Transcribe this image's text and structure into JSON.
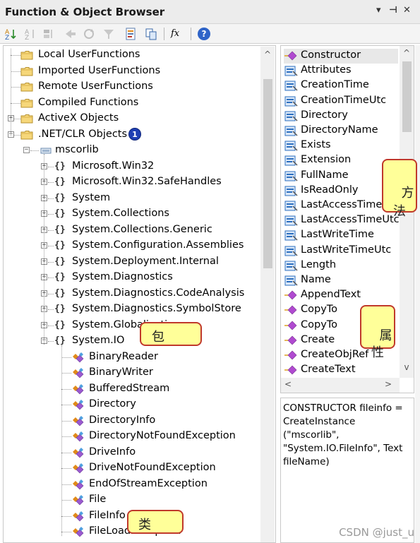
{
  "window": {
    "title": "Function & Object Browser",
    "controls": {
      "menu": "▾",
      "pin": "⊣",
      "close": "✕"
    }
  },
  "toolbar": {
    "icons": [
      "sort-icon",
      "sort-disabled-icon",
      "sort-disabled-icon",
      "arrow-disabled-icon",
      "refresh-disabled-icon",
      "filter-disabled-icon",
      "properties-icon",
      "copy-icon",
      "function-icon",
      "help-icon"
    ],
    "function_label": "fx",
    "help_label": "?"
  },
  "tree": {
    "root_folders": [
      {
        "label": "Local UserFunctions"
      },
      {
        "label": "Imported UserFunctions"
      },
      {
        "label": "Remote UserFunctions"
      },
      {
        "label": "Compiled Functions"
      },
      {
        "label": "ActiveX Objects"
      },
      {
        "label": ".NET/CLR Objects"
      }
    ],
    "assembly": "mscorlib",
    "namespaces": [
      "Microsoft.Win32",
      "Microsoft.Win32.SafeHandles",
      "System",
      "System.Collections",
      "System.Collections.Generic",
      "System.Configuration.Assemblies",
      "System.Deployment.Internal",
      "System.Diagnostics",
      "System.Diagnostics.CodeAnalysis",
      "System.Diagnostics.SymbolStore",
      "System.Globalization",
      "System.IO"
    ],
    "classes": [
      "BinaryReader",
      "BinaryWriter",
      "BufferedStream",
      "Directory",
      "DirectoryInfo",
      "DirectoryNotFoundException",
      "DriveInfo",
      "DriveNotFoundException",
      "EndOfStreamException",
      "File",
      "FileInfo",
      "FileLoadException"
    ],
    "ns_glyph": "{}",
    "expand_glyph": "+",
    "collapse_glyph": "−"
  },
  "members": {
    "items": [
      {
        "label": "Constructor",
        "kind": "method"
      },
      {
        "label": "Attributes",
        "kind": "property"
      },
      {
        "label": "CreationTime",
        "kind": "property"
      },
      {
        "label": "CreationTimeUtc",
        "kind": "property"
      },
      {
        "label": "Directory",
        "kind": "property"
      },
      {
        "label": "DirectoryName",
        "kind": "property"
      },
      {
        "label": "Exists",
        "kind": "property"
      },
      {
        "label": "Extension",
        "kind": "property"
      },
      {
        "label": "FullName",
        "kind": "property"
      },
      {
        "label": "IsReadOnly",
        "kind": "property"
      },
      {
        "label": "LastAccessTime",
        "kind": "property"
      },
      {
        "label": "LastAccessTimeUtc",
        "kind": "property"
      },
      {
        "label": "LastWriteTime",
        "kind": "property"
      },
      {
        "label": "LastWriteTimeUtc",
        "kind": "property"
      },
      {
        "label": "Length",
        "kind": "property"
      },
      {
        "label": "Name",
        "kind": "property"
      },
      {
        "label": "AppendText",
        "kind": "method"
      },
      {
        "label": "CopyTo",
        "kind": "method"
      },
      {
        "label": "CopyTo",
        "kind": "method"
      },
      {
        "label": "Create",
        "kind": "method"
      },
      {
        "label": "CreateObjRef",
        "kind": "method"
      },
      {
        "label": "CreateText",
        "kind": "method"
      }
    ]
  },
  "description": {
    "text": "CONSTRUCTOR fileinfo = CreateInstance (\"mscorlib\", \"System.IO.FileInfo\", Text fileName)"
  },
  "annotations": {
    "badge": "1",
    "package": "包",
    "method": "方\n法",
    "property": "属\n性",
    "class": "类"
  },
  "scroll": {
    "up": "^",
    "down": "v",
    "left": "<",
    "right": ">"
  },
  "watermark": "CSDN @just_u",
  "colors": {
    "callout_fill": "#ffff99",
    "callout_border": "#c0392b",
    "badge": "#1f3fb3",
    "method_icon": "#b04ad0",
    "property_icon": "#2d6fbf"
  }
}
